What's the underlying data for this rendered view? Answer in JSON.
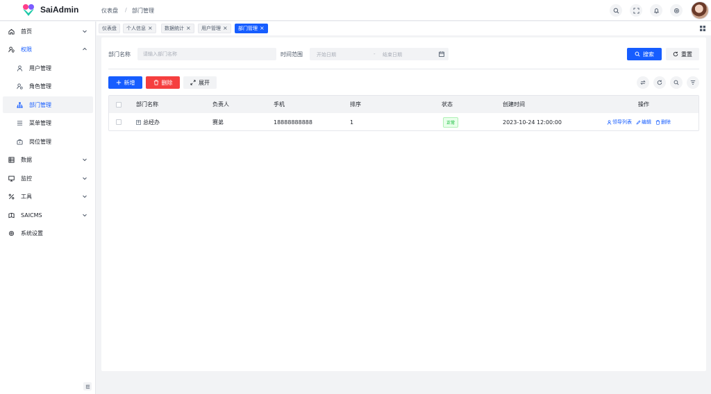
{
  "app": {
    "brand": "SaiAdmin"
  },
  "breadcrumb": {
    "home": "仪表盘",
    "separator": "/",
    "current": "部门管理"
  },
  "header_icons": [
    "search-icon",
    "fullscreen-icon",
    "bell-icon",
    "settings-icon"
  ],
  "sidebar": {
    "items": [
      {
        "label": "首页",
        "icon": "home-icon",
        "has_arrow": true
      },
      {
        "label": "权限",
        "icon": "user-shield-icon",
        "has_arrow": true,
        "open": true
      },
      {
        "label": "用户管理",
        "icon": "user-icon",
        "sub": true
      },
      {
        "label": "角色管理",
        "icon": "role-icon",
        "sub": true
      },
      {
        "label": "部门管理",
        "icon": "org-icon",
        "sub": true,
        "active": true
      },
      {
        "label": "菜单管理",
        "icon": "menu-icon",
        "sub": true
      },
      {
        "label": "岗位管理",
        "icon": "post-icon",
        "sub": true
      },
      {
        "label": "数据",
        "icon": "data-icon",
        "has_arrow": true
      },
      {
        "label": "监控",
        "icon": "monitor-icon",
        "has_arrow": true
      },
      {
        "label": "工具",
        "icon": "tool-icon",
        "has_arrow": true
      },
      {
        "label": "SAICMS",
        "icon": "cms-icon",
        "has_arrow": true
      },
      {
        "label": "系统设置",
        "icon": "gear-icon"
      }
    ]
  },
  "tabs": [
    {
      "label": "仪表盘",
      "closable": false
    },
    {
      "label": "个人信息",
      "closable": true
    },
    {
      "label": "数据统计",
      "closable": true
    },
    {
      "label": "用户管理",
      "closable": true
    },
    {
      "label": "部门管理",
      "closable": true,
      "active": true
    }
  ],
  "tab_close_glyph": "×",
  "search_form": {
    "dept_name_label": "部门名称",
    "dept_name_placeholder": "请输入部门名称",
    "time_range_label": "时间范围",
    "start_placeholder": "开始日期",
    "range_separator": "-",
    "end_placeholder": "结束日期",
    "search_button": "搜索",
    "reset_button": "重置"
  },
  "toolbar": {
    "add_button": "新增",
    "delete_button": "删除",
    "expand_button": "展开"
  },
  "table": {
    "columns": [
      "部门名称",
      "负责人",
      "手机",
      "排序",
      "状态",
      "创建时间",
      "操作"
    ],
    "rows": [
      {
        "expand_glyph": "+",
        "name": "总经办",
        "leader": "赛弟",
        "phone": "18888888888",
        "sort": "1",
        "status": "正常",
        "created_at": "2023-10-24 12:00:00",
        "actions": [
          "领导列表",
          "编辑",
          "删除"
        ]
      }
    ]
  },
  "colors": {
    "primary": "#165dff",
    "danger": "#f53f3f",
    "success": "#00b42a"
  }
}
